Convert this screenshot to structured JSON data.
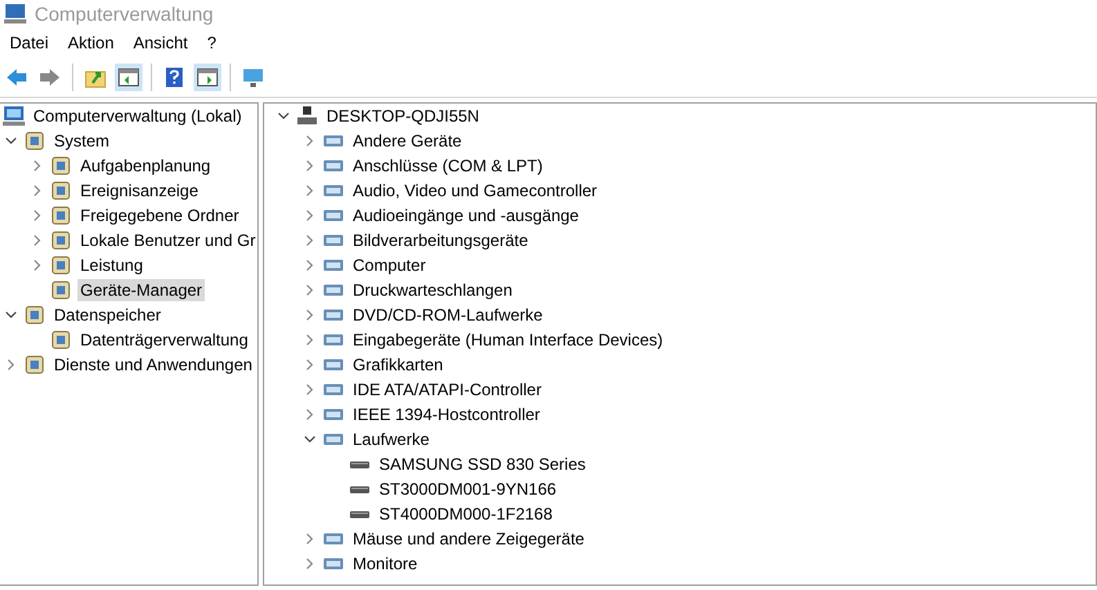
{
  "window": {
    "title": "Computerverwaltung"
  },
  "menu": [
    "Datei",
    "Aktion",
    "Ansicht",
    "?"
  ],
  "toolbar": [
    {
      "kind": "back"
    },
    {
      "kind": "forward"
    },
    {
      "kind": "sep"
    },
    {
      "kind": "up"
    },
    {
      "kind": "pane"
    },
    {
      "kind": "sep"
    },
    {
      "kind": "help"
    },
    {
      "kind": "pane2"
    },
    {
      "kind": "sep"
    },
    {
      "kind": "monitor"
    }
  ],
  "console_tree": [
    {
      "label": "Computerverwaltung (Lokal)",
      "selected": false,
      "children": [
        {
          "label": "System",
          "expanded": true,
          "selected": false,
          "children": [
            {
              "label": "Aufgabenplanung",
              "expanded": false,
              "selected": false
            },
            {
              "label": "Ereignisanzeige",
              "expanded": false,
              "selected": false
            },
            {
              "label": "Freigegebene Ordner",
              "expanded": false,
              "selected": false
            },
            {
              "label": "Lokale Benutzer und Gr",
              "expanded": false,
              "selected": false
            },
            {
              "label": "Leistung",
              "expanded": false,
              "selected": false
            },
            {
              "label": "Geräte-Manager",
              "selected": true
            }
          ]
        },
        {
          "label": "Datenspeicher",
          "expanded": true,
          "selected": false,
          "children": [
            {
              "label": "Datenträgerverwaltung",
              "selected": false
            }
          ]
        },
        {
          "label": "Dienste und Anwendungen",
          "expanded": false,
          "selected": false
        }
      ]
    }
  ],
  "device_tree": [
    {
      "label": "DESKTOP-QDJI55N",
      "expanded": true,
      "children": [
        {
          "label": "Andere Geräte",
          "expanded": false
        },
        {
          "label": "Anschlüsse (COM & LPT)",
          "expanded": false
        },
        {
          "label": "Audio, Video und Gamecontroller",
          "expanded": false
        },
        {
          "label": "Audioeingänge und -ausgänge",
          "expanded": false
        },
        {
          "label": "Bildverarbeitungsgeräte",
          "expanded": false
        },
        {
          "label": "Computer",
          "expanded": false
        },
        {
          "label": "Druckwarteschlangen",
          "expanded": false
        },
        {
          "label": "DVD/CD-ROM-Laufwerke",
          "expanded": false
        },
        {
          "label": "Eingabegeräte (Human Interface Devices)",
          "expanded": false
        },
        {
          "label": "Grafikkarten",
          "expanded": false
        },
        {
          "label": "IDE ATA/ATAPI-Controller",
          "expanded": false
        },
        {
          "label": "IEEE 1394-Hostcontroller",
          "expanded": false
        },
        {
          "label": "Laufwerke",
          "expanded": true,
          "children": [
            {
              "label": "SAMSUNG SSD 830 Series"
            },
            {
              "label": "ST3000DM001-9YN166"
            },
            {
              "label": "ST4000DM000-1F2168"
            }
          ]
        },
        {
          "label": "Mäuse und andere Zeigegeräte",
          "expanded": false
        },
        {
          "label": "Monitore",
          "expanded": false
        }
      ]
    }
  ]
}
